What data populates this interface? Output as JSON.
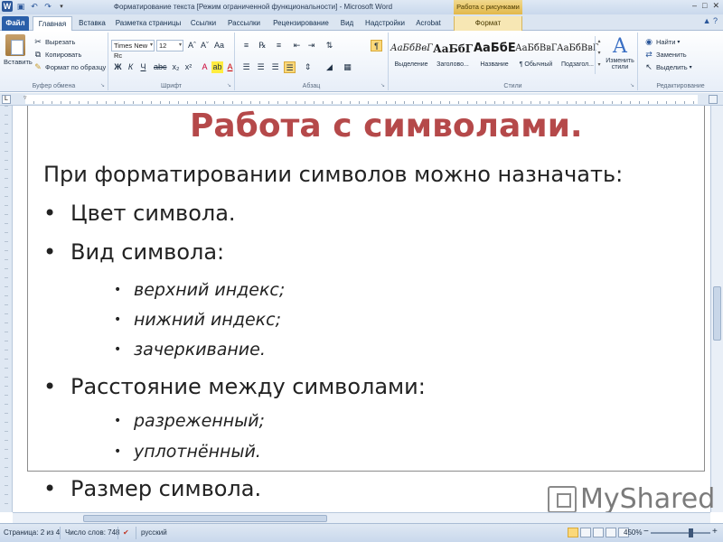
{
  "titlebar": {
    "title": "Форматирование текста [Режим ограниченной функциональности] - Microsoft Word",
    "context_group": "Работа с рисунками",
    "icons": [
      "word-icon",
      "save-icon",
      "undo-icon",
      "redo-icon",
      "qat-dropdown-icon"
    ]
  },
  "tabs": [
    {
      "label": "Файл"
    },
    {
      "label": "Главная"
    },
    {
      "label": "Вставка"
    },
    {
      "label": "Разметка страницы"
    },
    {
      "label": "Ссылки"
    },
    {
      "label": "Рассылки"
    },
    {
      "label": "Рецензирование"
    },
    {
      "label": "Вид"
    },
    {
      "label": "Надстройки"
    },
    {
      "label": "Acrobat"
    },
    {
      "label": "Формат"
    }
  ],
  "ribbon": {
    "clipboard": {
      "paste": "Вставить",
      "cut": "Вырезать",
      "copy": "Копировать",
      "format_painter": "Формат по образцу",
      "label": "Буфер обмена"
    },
    "font": {
      "font_name": "Times New Rc",
      "font_size": "12",
      "label": "Шрифт"
    },
    "paragraph": {
      "label": "Абзац"
    },
    "styles": {
      "items": [
        {
          "preview": "АаБбВвГ",
          "label": "Выделение"
        },
        {
          "preview": "АаБбГ",
          "label": "Заголово..."
        },
        {
          "preview": "АаБбЕ",
          "label": "Название"
        },
        {
          "preview": "АаБбВвГ",
          "label": "¶ Обычный"
        },
        {
          "preview": "АаБбВвГ",
          "label": "Подзагол..."
        }
      ],
      "change_styles": "Изменить стили",
      "label": "Стили"
    },
    "editing": {
      "find": "Найти",
      "replace": "Заменить",
      "select": "Выделить",
      "label": "Редактирование"
    }
  },
  "document": {
    "title": "Работа с символами.",
    "intro": "При форматировании символов можно назначать:",
    "bullet": "•",
    "items": [
      {
        "text": "Цвет символа."
      },
      {
        "text": "Вид символа:",
        "sub": [
          "верхний индекс;",
          "нижний индекс;",
          "зачеркивание."
        ]
      },
      {
        "text": "Расстояние между символами:",
        "sub": [
          "разреженный;",
          "уплотнённый."
        ]
      },
      {
        "text": "Размер символа."
      }
    ]
  },
  "watermark": "MyShared",
  "status": {
    "page": "Страница: 2 из 4",
    "words": "Число слов: 748",
    "language": "русский",
    "zoom": "450%"
  },
  "colors": {
    "title_red": "#b5494a",
    "file_tab": "#2a5fa9",
    "context_tab": "#e2b84a",
    "ribbon_bg": "#e7eef8"
  }
}
